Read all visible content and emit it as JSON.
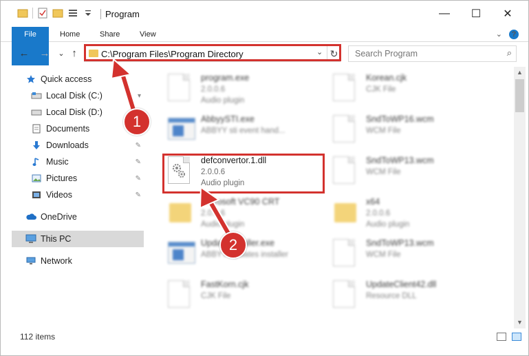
{
  "window": {
    "title": "Program",
    "controls": {
      "minimize": "—",
      "maximize": "☐",
      "close": "✕"
    }
  },
  "ribbon": {
    "tabs": [
      "File",
      "Home",
      "Share",
      "View"
    ],
    "help": "?",
    "collapse": "⌄"
  },
  "nav": {
    "back": "←",
    "forward": "→",
    "recent": "⌄",
    "up": "↑",
    "address": "C:\\Program Files\\Program Directory",
    "dropdown": "⌄",
    "refresh": "↻",
    "search_placeholder": "Search Program",
    "search_icon": "⌕"
  },
  "sidebar": {
    "items": [
      {
        "label": "Quick access",
        "icon": "star-icon"
      },
      {
        "label": "Local Disk (C:)",
        "icon": "drive-icon"
      },
      {
        "label": "Local Disk (D:)",
        "icon": "drive-icon"
      },
      {
        "label": "Documents",
        "icon": "documents-icon"
      },
      {
        "label": "Downloads",
        "icon": "downloads-icon"
      },
      {
        "label": "Music",
        "icon": "music-icon"
      },
      {
        "label": "Pictures",
        "icon": "pictures-icon"
      },
      {
        "label": "Videos",
        "icon": "videos-icon"
      },
      {
        "label": "OneDrive",
        "icon": "cloud-icon"
      },
      {
        "label": "This PC",
        "icon": "computer-icon"
      },
      {
        "label": "Network",
        "icon": "network-icon"
      }
    ],
    "pin": "📌"
  },
  "files": [
    {
      "name": "program.exe",
      "line2": "2.0.0.6",
      "line3": "Audio plugin",
      "type": "exe-icon"
    },
    {
      "name": "Korean.cjk",
      "line2": "CJK File",
      "line3": "",
      "type": "page-icon"
    },
    {
      "name": "AbbyySTI.exe",
      "line2": "ABBYY sti event hand...",
      "line3": "",
      "type": "app-icon"
    },
    {
      "name": "SndToWP16.wcm",
      "line2": "WCM File",
      "line3": "",
      "type": "page-icon"
    },
    {
      "name": "defconvertor.1.dll",
      "line2": "2.0.0.6",
      "line3": "Audio plugin",
      "type": "dll-icon"
    },
    {
      "name": "SndToWP13.wcm",
      "line2": "WCM File",
      "line3": "",
      "type": "page-icon"
    },
    {
      "name": "Microsoft VC90 CRT",
      "line2": "2.0.0.6",
      "line3": "Audio plugin",
      "type": "folder-icon"
    },
    {
      "name": "x64",
      "line2": "2.0.0.6",
      "line3": "Audio plugin",
      "type": "folder-icon"
    },
    {
      "name": "UpdateInstaller.exe",
      "line2": "ABBYY Updates installer",
      "line3": "",
      "type": "app-icon"
    },
    {
      "name": "SndToWP13.wcm",
      "line2": "WCM File",
      "line3": "",
      "type": "page-icon"
    },
    {
      "name": "FastKorn.cjk",
      "line2": "CJK File",
      "line3": "",
      "type": "page-icon"
    },
    {
      "name": "UpdateClient42.dll",
      "line2": "Resource DLL",
      "line3": "",
      "type": "page-icon"
    }
  ],
  "status": {
    "count": "112 items"
  },
  "annotations": {
    "badge1": "1",
    "badge2": "2"
  },
  "colors": {
    "accent": "#1979ca",
    "annotation": "#d3322e",
    "selected": "#d9d9d9"
  }
}
